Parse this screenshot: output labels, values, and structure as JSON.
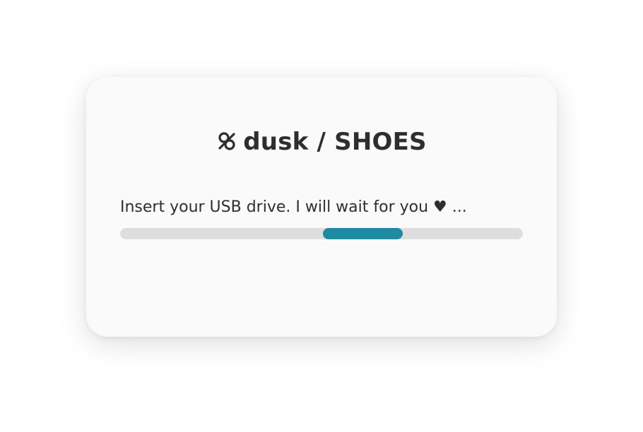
{
  "dialog": {
    "app_name": "dusk / SHOES",
    "logo_icon": "dusk-logo-icon",
    "message": "Insert your USB drive. I will wait for you ♥ ...",
    "progress": {
      "mode": "indeterminate",
      "pulse_start_fraction": 0.503,
      "pulse_end_fraction": 0.702,
      "accent_color": "#1f8aa0",
      "track_color": "#dedede"
    }
  }
}
